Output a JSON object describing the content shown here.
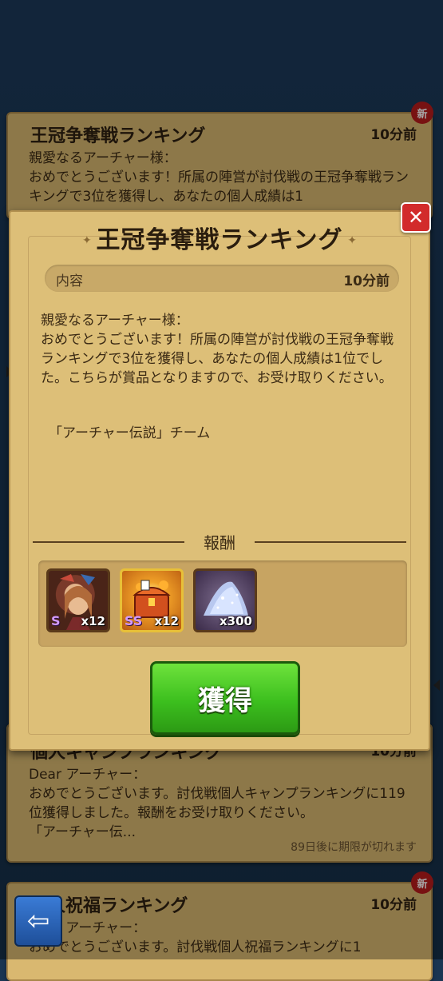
{
  "background_mails": [
    {
      "title": "王冠争奪戦ランキング",
      "time": "10分前",
      "body": "親愛なるアーチャー様：\nおめでとうございます！所属の陣営が討伐戦の王冠争奪戦ランキングで3位を獲得し、あなたの個人成績は1",
      "badge": "新"
    },
    {
      "title": "個人キャンプランキング",
      "time": "10分前",
      "body": "Dear アーチャー：\nおめでとうございます。討伐戦個人キャンプランキングに119位獲得しました。報酬をお受け取りください。\n「アーチャー伝...",
      "expire": "89日後に期限が切れます"
    },
    {
      "title": "個人祝福ランキング",
      "time": "10分前",
      "body": "Dear アーチャー：\nおめでとうございます。討伐戦個人祝福ランキングに1",
      "badge": "新"
    }
  ],
  "modal": {
    "title": "王冠争奪戦ランキング",
    "content_label": "内容",
    "time": "10分前",
    "message": "親愛なるアーチャー様：\nおめでとうございます！所属の陣営が討伐戦の王冠争奪戦ランキングで3位を獲得し、あなたの個人成績は1位でした。こちらが賞品となりますので、お受け取りください。",
    "signature": "「アーチャー伝説」チーム",
    "reward_label": "報酬",
    "rewards": [
      {
        "name": "hero-shard",
        "rank": "S",
        "qty": "x12"
      },
      {
        "name": "ss-chest",
        "rank": "SS",
        "qty": "x12"
      },
      {
        "name": "gem-dust",
        "rank": "",
        "qty": "x300"
      }
    ],
    "obtain_button": "獲得",
    "close_icon": "close-icon"
  },
  "back_button_icon": "back-arrow-icon"
}
